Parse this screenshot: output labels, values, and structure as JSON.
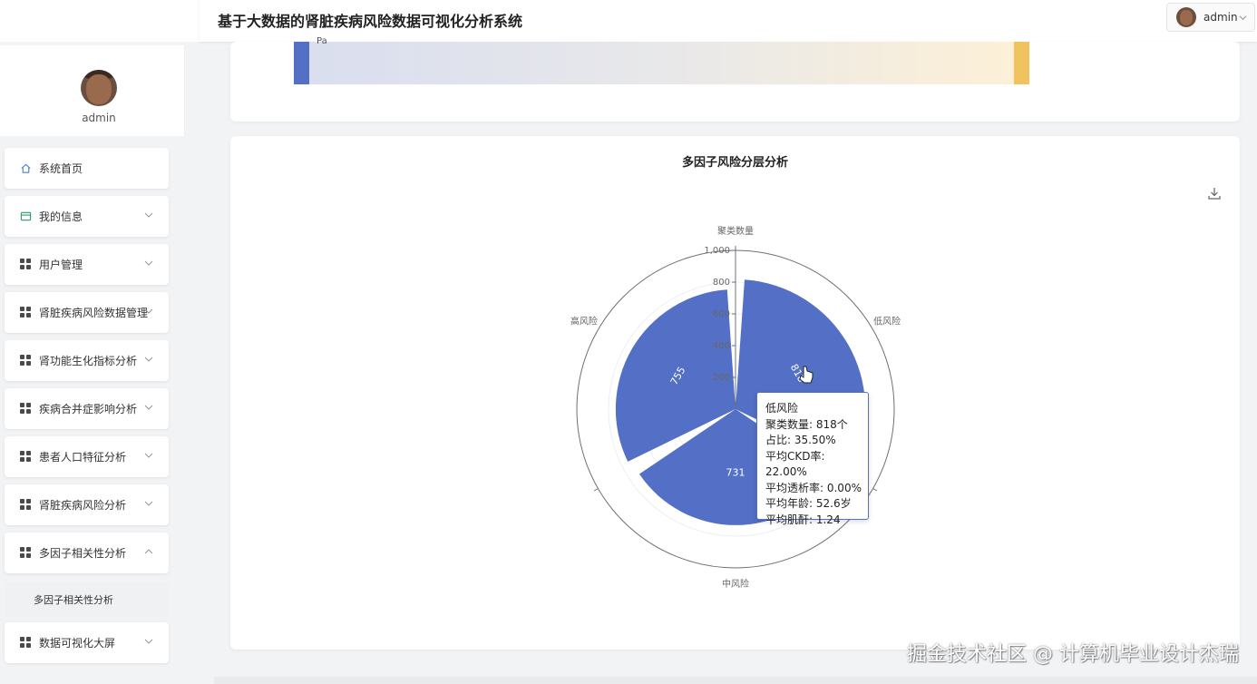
{
  "header": {
    "title": "基于大数据的肾脏疾病风险数据可视化分析系统",
    "user_name": "admin"
  },
  "profile": {
    "name": "admin"
  },
  "sidebar": {
    "items": [
      {
        "label": "系统首页",
        "icon": "home-icon"
      },
      {
        "label": "我的信息",
        "icon": "id-card-icon"
      },
      {
        "label": "用户管理",
        "icon": "grid-icon"
      },
      {
        "label": "肾脏疾病风险数据管理",
        "icon": "grid-icon"
      },
      {
        "label": "肾功能生化指标分析",
        "icon": "grid-icon"
      },
      {
        "label": "疾病合并症影响分析",
        "icon": "grid-icon"
      },
      {
        "label": "患者人口特征分析",
        "icon": "grid-icon"
      },
      {
        "label": "肾脏疾病风险分析",
        "icon": "grid-icon"
      },
      {
        "label": "多因子相关性分析",
        "icon": "grid-icon"
      },
      {
        "label": "数据可视化大屏",
        "icon": "grid-icon"
      }
    ],
    "sub_item": "多因子相关性分析"
  },
  "top_card": {
    "label": "Pa"
  },
  "chart_data": {
    "type": "polar-bar",
    "title": "多因子风险分层分析",
    "categories": [
      "低风险",
      "中风险",
      "高风险"
    ],
    "series": [
      {
        "values": [
          818,
          731,
          755
        ]
      }
    ],
    "radial_axis_name": "聚类数量",
    "radial_ticks": [
      "200",
      "400",
      "600",
      "800",
      "1,000"
    ],
    "ylim": [
      0,
      1000
    ],
    "color": "#5470c6"
  },
  "tooltip": {
    "title": "低风险",
    "lines": [
      "聚类数量: 818个",
      "占比: 35.50%",
      "平均CKD率: 22.00%",
      "平均透析率: 0.00%",
      "平均年龄: 52.6岁",
      "平均肌酐: 1.24"
    ]
  },
  "watermark": "掘金技术社区 @ 计算机毕业设计杰瑞"
}
